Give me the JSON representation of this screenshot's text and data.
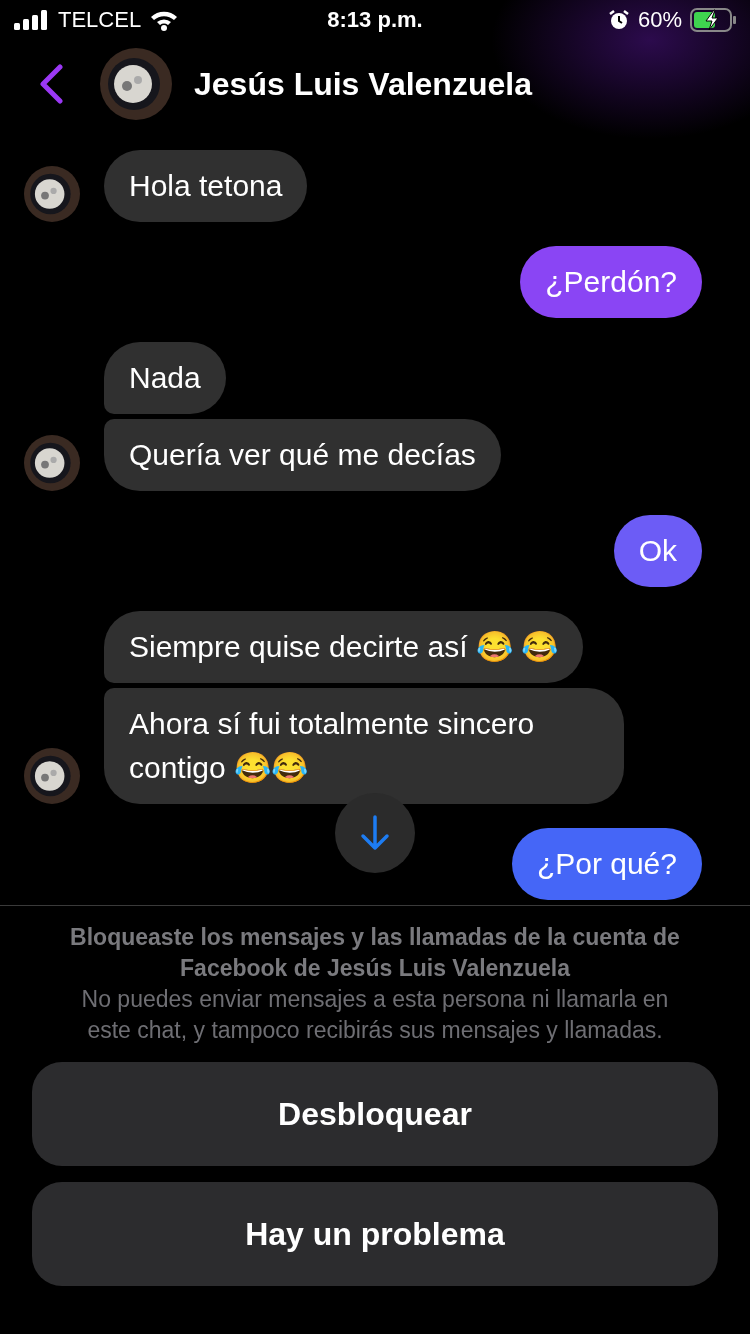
{
  "status_bar": {
    "carrier": "TELCEL",
    "time": "8:13 p.m.",
    "battery": "60%"
  },
  "header": {
    "name": "Jesús Luis Valenzuela"
  },
  "messages": [
    {
      "kind": "them",
      "text": "Hola tetona",
      "avatar": true,
      "group_start": true
    },
    {
      "kind": "me",
      "text": "¿Perdón?",
      "color": "#8a45f4",
      "group_start": true
    },
    {
      "kind": "them",
      "text": "Nada",
      "avatar": false,
      "group_start": true
    },
    {
      "kind": "them",
      "text": "Quería ver qué me decías",
      "avatar": true,
      "group_start": false
    },
    {
      "kind": "me",
      "text": "Ok",
      "color": "#6c5cf6",
      "group_start": true
    },
    {
      "kind": "them",
      "text": "Siempre quise decirte así 😂 😂",
      "avatar": false,
      "group_start": true
    },
    {
      "kind": "them",
      "text": "Ahora sí fui totalmente sincero contigo 😂😂",
      "avatar": true,
      "group_start": false
    },
    {
      "kind": "me",
      "text": "¿Por qué?",
      "color": "#4566f7",
      "group_start": true
    }
  ],
  "blocked_notice": {
    "title": "Bloqueaste los mensajes y las llamadas de la cuenta de Facebook de Jesús Luis Valenzuela",
    "body": "No puedes enviar mensajes a esta persona ni llamarla en este chat, y tampoco recibirás sus mensajes y llamadas."
  },
  "buttons": [
    "Desbloquear",
    "Hay un problema"
  ]
}
